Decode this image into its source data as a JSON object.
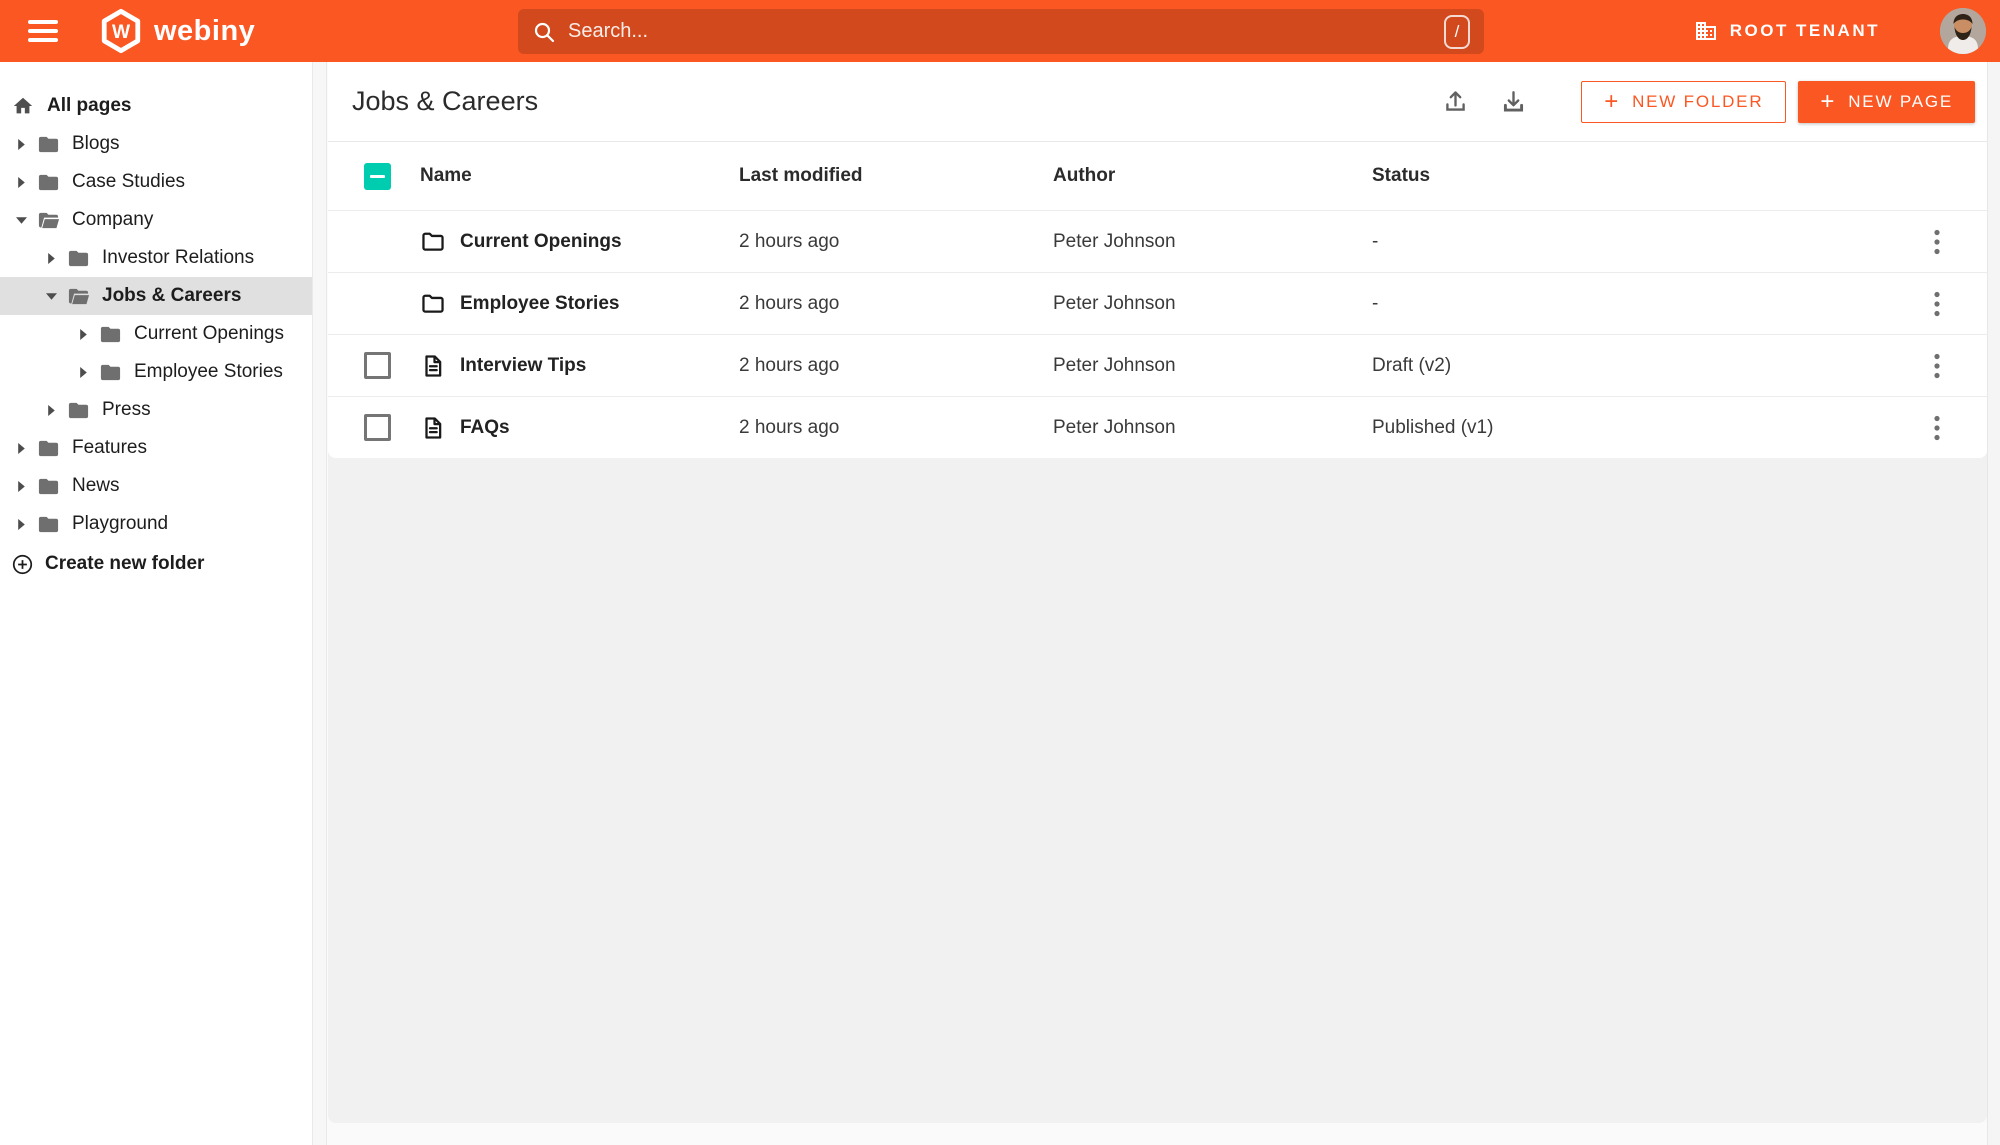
{
  "topbar": {
    "brand": "webiny",
    "search_placeholder": "Search...",
    "search_shortcut": "/",
    "tenant": "ROOT TENANT"
  },
  "sidebar": {
    "root_label": "All pages",
    "items": [
      {
        "label": "Blogs",
        "level": 0,
        "expanded": false,
        "selected": false
      },
      {
        "label": "Case Studies",
        "level": 0,
        "expanded": false,
        "selected": false
      },
      {
        "label": "Company",
        "level": 0,
        "expanded": true,
        "selected": false
      },
      {
        "label": "Investor Relations",
        "level": 1,
        "expanded": false,
        "selected": false
      },
      {
        "label": "Jobs & Careers",
        "level": 1,
        "expanded": true,
        "selected": true
      },
      {
        "label": "Current Openings",
        "level": 2,
        "expanded": false,
        "selected": false
      },
      {
        "label": "Employee Stories",
        "level": 2,
        "expanded": false,
        "selected": false
      },
      {
        "label": "Press",
        "level": 1,
        "expanded": false,
        "selected": false
      },
      {
        "label": "Features",
        "level": 0,
        "expanded": false,
        "selected": false
      },
      {
        "label": "News",
        "level": 0,
        "expanded": false,
        "selected": false
      },
      {
        "label": "Playground",
        "level": 0,
        "expanded": false,
        "selected": false
      }
    ],
    "create_label": "Create new folder"
  },
  "main": {
    "title": "Jobs & Careers",
    "actions": {
      "new_folder": "NEW FOLDER",
      "new_page": "NEW PAGE",
      "plus": "+"
    },
    "table": {
      "columns": [
        "Name",
        "Last modified",
        "Author",
        "Status"
      ],
      "header_checkbox_state": "indeterminate",
      "rows": [
        {
          "type": "folder",
          "name": "Current Openings",
          "modified": "2 hours ago",
          "author": "Peter Johnson",
          "status": "-",
          "has_checkbox": false
        },
        {
          "type": "folder",
          "name": "Employee Stories",
          "modified": "2 hours ago",
          "author": "Peter Johnson",
          "status": "-",
          "has_checkbox": false
        },
        {
          "type": "page",
          "name": "Interview Tips",
          "modified": "2 hours ago",
          "author": "Peter Johnson",
          "status": "Draft (v2)",
          "has_checkbox": true
        },
        {
          "type": "page",
          "name": "FAQs",
          "modified": "2 hours ago",
          "author": "Peter Johnson",
          "status": "Published (v1)",
          "has_checkbox": true
        }
      ]
    }
  },
  "icons": {
    "menu": "hamburger",
    "logo": "hexagon-w",
    "search": "magnifier",
    "shortcut_badge": "slash-key",
    "tenant": "building",
    "avatar": "user-photo",
    "root": "home",
    "expand": "triangle-right",
    "collapse": "triangle-down",
    "folder_closed": "folder-filled",
    "folder_open": "folder-open-filled",
    "create_folder": "circle-plus",
    "export": "arrow-up-tray",
    "import": "arrow-down-tray",
    "row_folder": "folder-outline",
    "row_page": "document-outline",
    "row_menu": "kebab-vertical"
  },
  "colors": {
    "brand_orange": "#fa5723",
    "accent_teal": "#00ccb0",
    "selected_bg": "#e0e0e0",
    "panel_bg": "#f1f1f1"
  }
}
